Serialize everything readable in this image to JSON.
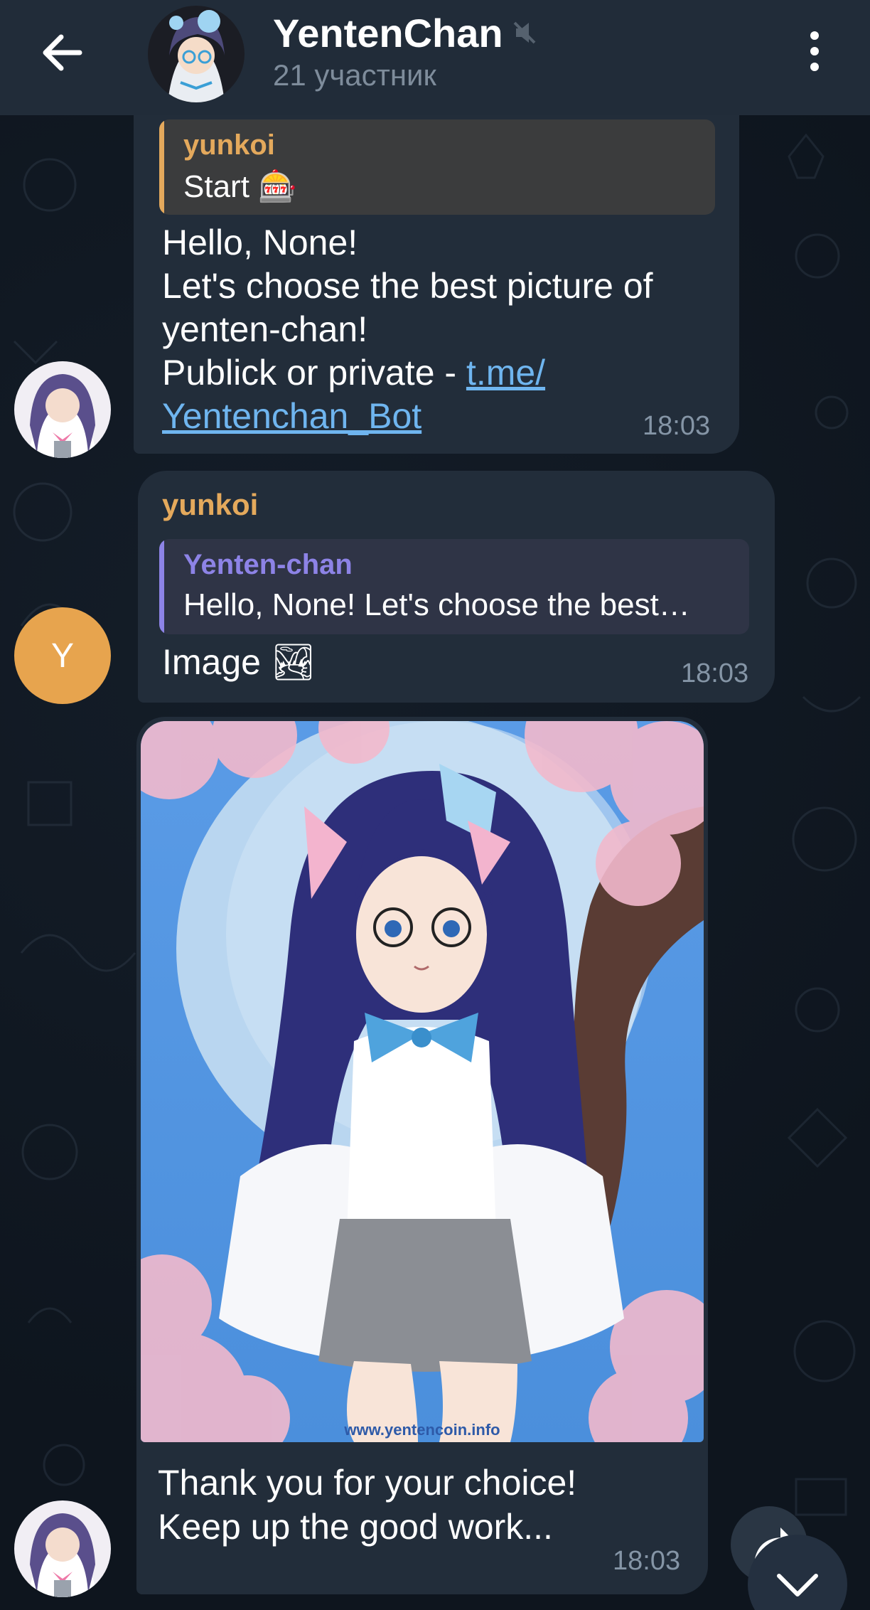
{
  "header": {
    "title": "YentenChan",
    "subtitle": "21 участник"
  },
  "messages": {
    "m1": {
      "reply_name": "yunkoi",
      "reply_text": "Start 🎰",
      "line1": "Hello, None!",
      "line2": "Let's choose the best picture of",
      "line3": "yenten-chan!",
      "line4_prefix": "Publick or private - ",
      "link_part1": "t.me/",
      "link_part2": "Yentenchan_Bot",
      "time": "18:03"
    },
    "m2": {
      "sender": "yunkoi",
      "avatar_letter": "Y",
      "reply_name": "Yenten-chan",
      "reply_text": "Hello, None!  Let's choose the best…",
      "text": "Image 🏞",
      "time": "18:03"
    },
    "m3": {
      "watermark": "www.yentencoin.info",
      "line1": "Thank you for your choice!",
      "line2": "Keep up the good work...",
      "time": "18:03"
    }
  },
  "colors": {
    "header_bg": "#212c39",
    "bubble_bg": "#222d3a",
    "reply_user_accent": "#e4a95c",
    "reply_bot_accent": "#8d83e6",
    "avatar_orange": "#e7a44e",
    "link": "#6fb5ef"
  },
  "icons": {
    "back": "arrow-left-icon",
    "mute": "mute-icon",
    "menu": "more-vertical-icon",
    "share": "share-icon",
    "scroll": "chevron-down-icon"
  }
}
